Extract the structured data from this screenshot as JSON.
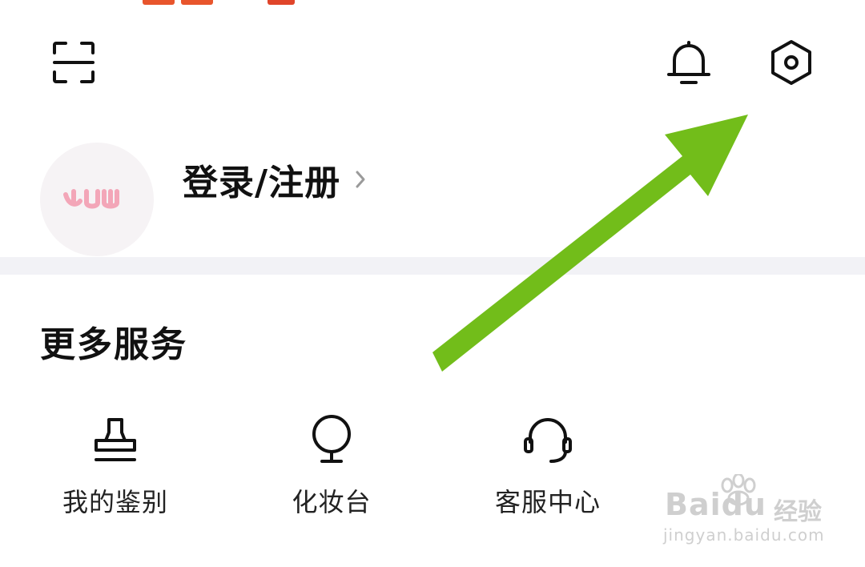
{
  "header": {
    "scan_icon": "scan-icon",
    "notification_icon": "bell-icon",
    "settings_icon": "hexagon-gear-icon"
  },
  "profile": {
    "avatar_icon": "avatar-placeholder-icon",
    "login_label": "登录/注册",
    "chevron_icon": "chevron-right-icon"
  },
  "more_services": {
    "title": "更多服务",
    "items": [
      {
        "label": "我的鉴别",
        "icon": "stamp-icon"
      },
      {
        "label": "化妆台",
        "icon": "mirror-icon"
      },
      {
        "label": "客服中心",
        "icon": "headset-icon"
      }
    ]
  },
  "annotation": {
    "arrow_color": "#72bd1a"
  },
  "watermark": {
    "brand": "Baidu",
    "sub": "经验",
    "url": "jingyan.baidu.com"
  },
  "colors": {
    "status_accent_1": "#e8552c",
    "status_accent_2": "#e0452a",
    "avatar_bg": "#f6f3f5",
    "avatar_mark": "#f3a6b8",
    "divider": "#f2f2f6"
  }
}
